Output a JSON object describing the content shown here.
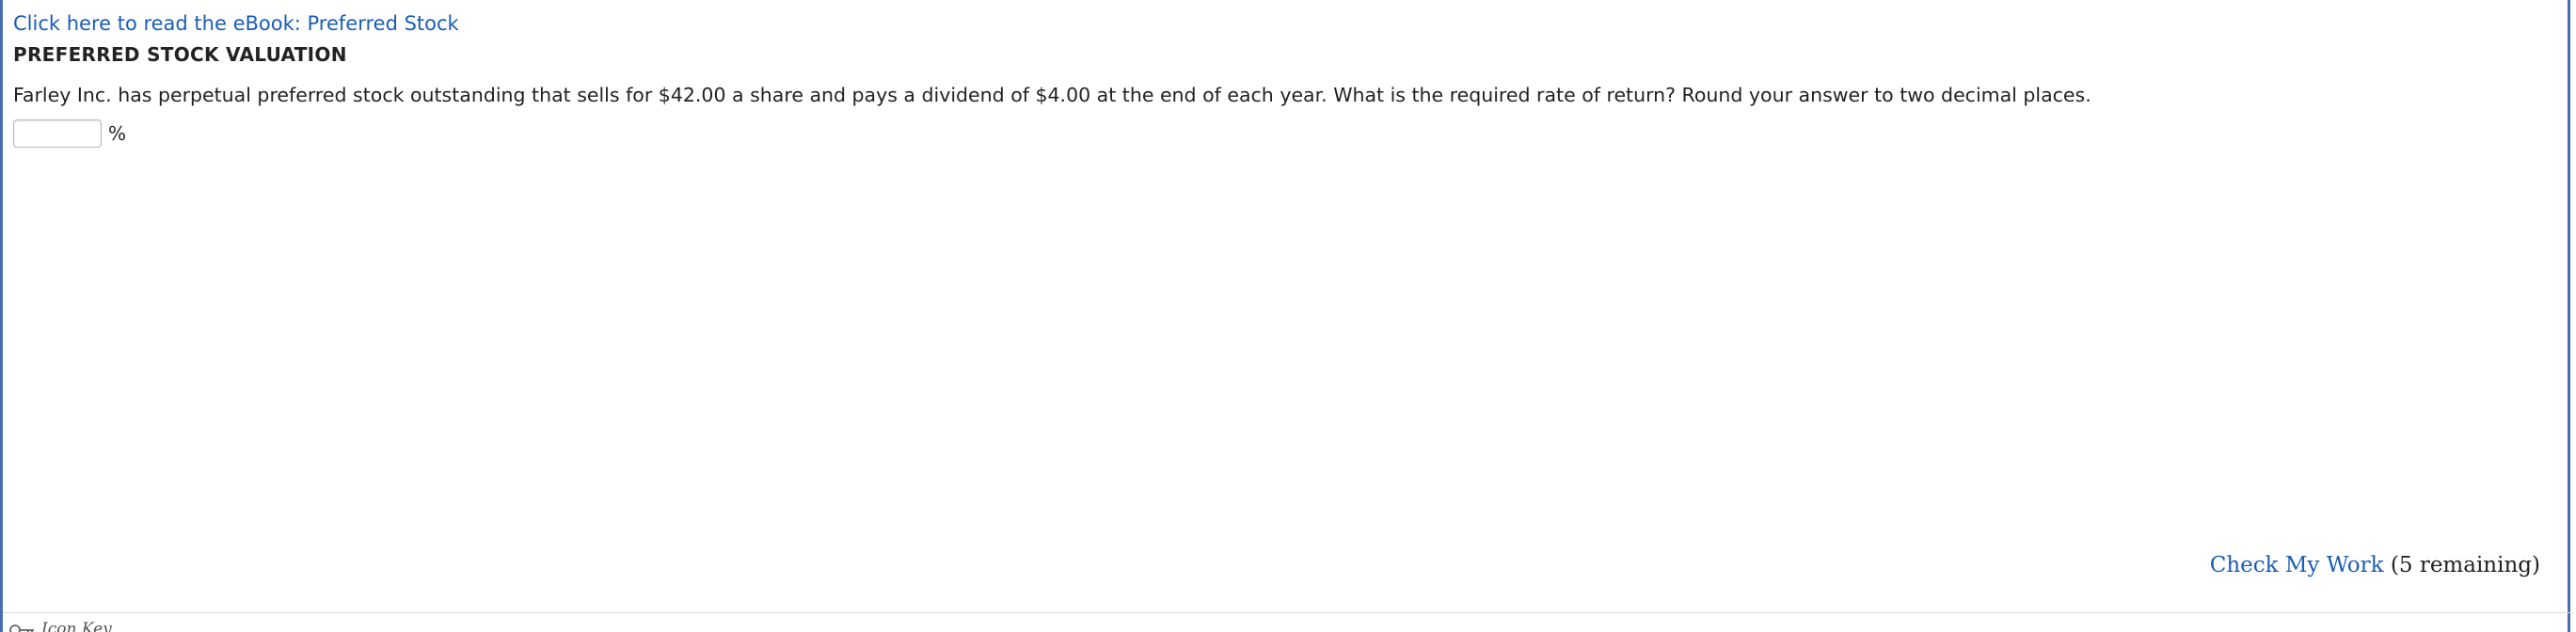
{
  "ebook_link": {
    "label": "Click here to read the eBook: Preferred Stock"
  },
  "problem": {
    "title": "PREFERRED STOCK VALUATION",
    "question": "Farley Inc. has perpetual preferred stock outstanding that sells for $42.00 a share and pays a dividend of $4.00 at the end of each year. What is the required rate of return? Round your answer to two decimal places.",
    "answer_value": "",
    "unit": "%"
  },
  "check_work": {
    "label": "Check My Work",
    "remaining": "(5 remaining)"
  },
  "footer": {
    "icon_key_label": "Icon Key",
    "icon": "key-icon"
  },
  "colors": {
    "link": "#1a5db4",
    "frame_border": "#4a6fb0",
    "text": "#222222"
  }
}
